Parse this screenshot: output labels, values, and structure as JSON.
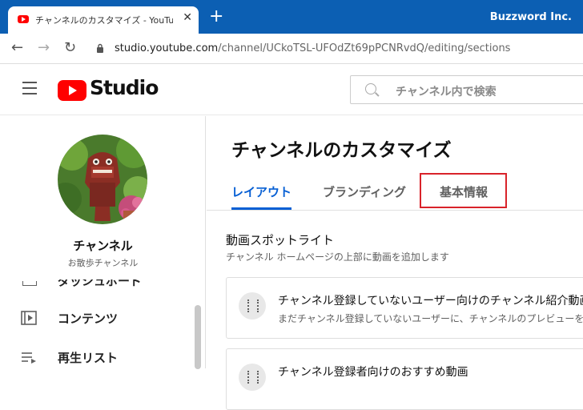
{
  "browser": {
    "tab_title": "チャンネルのカスタマイズ - YouTube Studio",
    "close_glyph": "✕",
    "new_tab_glyph": "+",
    "brand": "Buzzword Inc.",
    "back_glyph": "←",
    "forward_glyph": "→",
    "reload_glyph": "↻",
    "url_host": "studio.youtube.com",
    "url_path": "/channel/UCkoTSL-UFOdZt69pPCNRvdQ/editing/sections"
  },
  "header": {
    "logo_text": "Studio",
    "search_placeholder": "チャンネル内で検索"
  },
  "sidebar": {
    "channel_name": "チャンネル",
    "channel_handle": "お散歩チャンネル",
    "items": [
      {
        "label": "ダッシュボード",
        "icon": "dashboard-icon"
      },
      {
        "label": "コンテンツ",
        "icon": "content-icon"
      },
      {
        "label": "再生リスト",
        "icon": "playlist-icon"
      }
    ]
  },
  "main": {
    "title": "チャンネルのカスタマイズ",
    "tabs": [
      {
        "label": "レイアウト",
        "active": true
      },
      {
        "label": "ブランディング",
        "active": false
      },
      {
        "label": "基本情報",
        "active": false,
        "highlighted": true
      }
    ],
    "section": {
      "title": "動画スポットライト",
      "description": "チャンネル ホームページの上部に動画を追加します"
    },
    "cards": [
      {
        "title": "チャンネル登録していないユーザー向けのチャンネル紹介動画",
        "description": "まだチャンネル登録していないユーザーに、チャンネルのプレビューを表示します"
      },
      {
        "title": "チャンネル登録者向けのおすすめ動画",
        "description": ""
      }
    ]
  },
  "colors": {
    "titlebar": "#0c5fb3",
    "accent": "#065fd4",
    "youtube_red": "#ff0000",
    "highlight_box": "#d9232a"
  }
}
